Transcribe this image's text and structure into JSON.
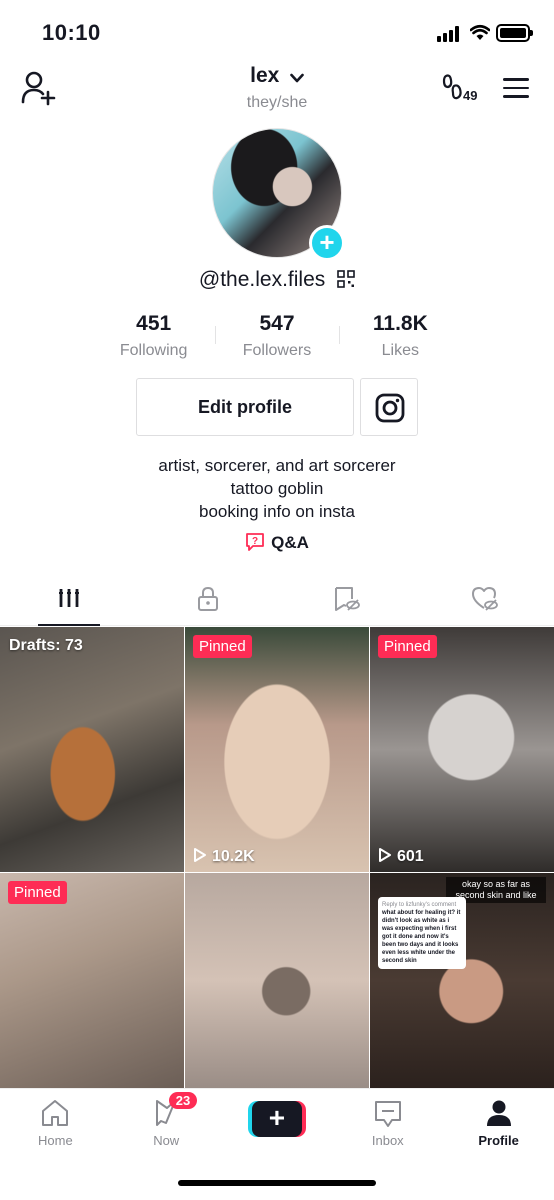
{
  "status": {
    "time": "10:10"
  },
  "header": {
    "username": "lex",
    "pronouns": "they/she",
    "profile_visitors_count": "49"
  },
  "profile": {
    "handle": "@the.lex.files",
    "stats": [
      {
        "value": "451",
        "label": "Following"
      },
      {
        "value": "547",
        "label": "Followers"
      },
      {
        "value": "11.8K",
        "label": "Likes"
      }
    ],
    "edit_label": "Edit profile",
    "bio": [
      "artist, sorcerer, and art sorcerer",
      "tattoo goblin",
      "booking info on insta"
    ],
    "qa_label": "Q&A"
  },
  "tabs": [
    "videos-grid-icon",
    "lock-icon",
    "tagged-icon",
    "liked-icon"
  ],
  "grid": {
    "drafts": "Drafts: 73",
    "pinned": "Pinned",
    "views": [
      "10.2K",
      "601"
    ],
    "caption": "okay so as far as second skin and like",
    "reply_header": "Reply to lizfunky's comment",
    "reply_text": "what about for healing it? it didn't look as white as i was expecting when i first got it done and now it's been two days and it looks even less white under the second skin"
  },
  "nav": {
    "items": [
      {
        "label": "Home"
      },
      {
        "label": "Now",
        "badge": "23"
      },
      {
        "label": ""
      },
      {
        "label": "Inbox"
      },
      {
        "label": "Profile"
      }
    ]
  },
  "colors": {
    "accent": "#fe2c55",
    "cyan": "#20d5ec",
    "text": "#161823",
    "muted": "#8a8b91"
  }
}
